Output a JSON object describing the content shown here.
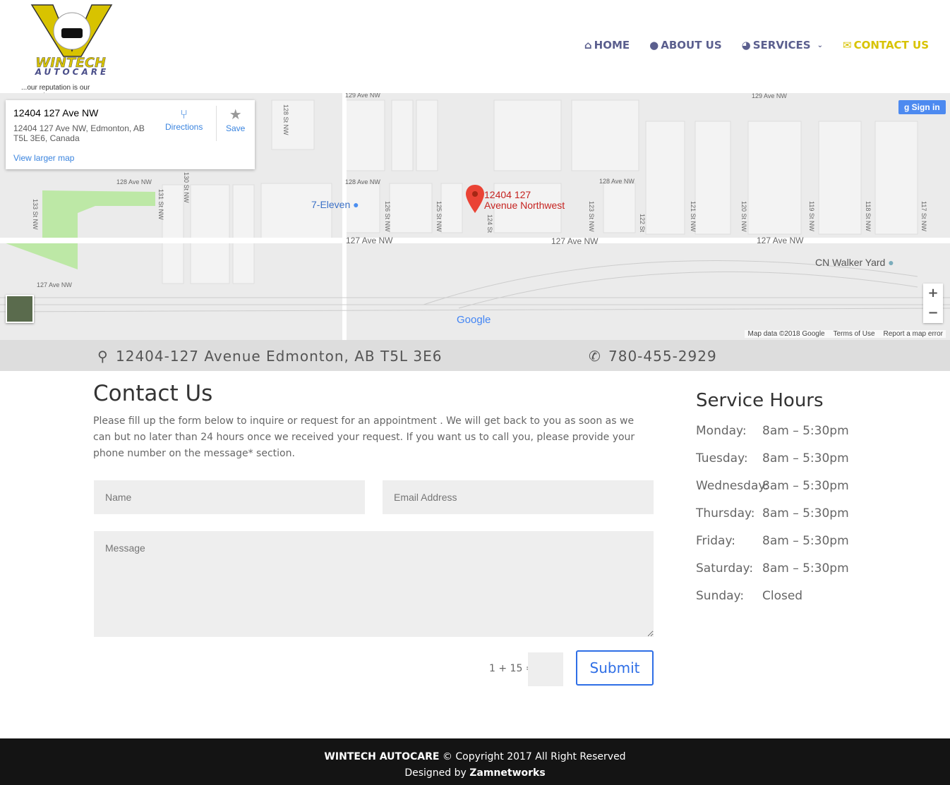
{
  "logo": {
    "brand": "WINTECH",
    "sub": "AUTOCARE",
    "tagline": "...our reputation is our guarantee"
  },
  "nav": [
    {
      "label": "HOME",
      "icon": "home-icon"
    },
    {
      "label": "ABOUT US",
      "icon": "users-icon"
    },
    {
      "label": "SERVICES",
      "icon": "pie-chart-icon"
    },
    {
      "label": "CONTACT US",
      "icon": "envelope-icon",
      "active": true
    }
  ],
  "colors": {
    "nav": "#5b5f8e",
    "accent": "#d8c300",
    "button": "#2e6ee6"
  },
  "map": {
    "place_title": "12404 127 Ave NW",
    "place_address_1": "12404 127 Ave NW, Edmonton, AB",
    "place_address_2": "T5L 3E6, Canada",
    "view_larger": "View larger map",
    "directions": "Directions",
    "save": "Save",
    "sign_in": "Sign in",
    "marker_label_1": "12404 127",
    "marker_label_2": "Avenue Northwest",
    "poi_1": "7-Eleven",
    "poi_2": "CN Walker Yard",
    "streets": [
      "129 Ave NW",
      "129 Ave NW",
      "128 Ave NW",
      "128 Ave NW",
      "128 Ave NW",
      "127 Ave NW",
      "127 Ave NW",
      "127 Ave NW",
      "127 Ave NW",
      "128 St NW",
      "130 St NW",
      "131 St NW",
      "133 St NW",
      "126 St NW",
      "125 St NW",
      "124 St",
      "123 St NW",
      "122 St",
      "121 St NW",
      "120 St NW",
      "119 St NW",
      "118 St NW",
      "117 St NW"
    ],
    "attribution": "Map data ©2018 Google",
    "terms": "Terms of Use",
    "report": "Report a map error",
    "google": "Google",
    "zoom_in": "+",
    "zoom_out": "−"
  },
  "info": {
    "address": "12404-127 Avenue Edmonton, AB T5L 3E6",
    "phone": "780-455-2929"
  },
  "contact": {
    "title": "Contact Us",
    "intro": "Please fill up the form below to inquire or request for an appointment . We will get back to you as soon as we can but no later than 24 hours once we received your request. If you want us to call you, please provide your phone number on the message* section.",
    "name_placeholder": "Name",
    "email_placeholder": "Email Address",
    "message_placeholder": "Message",
    "captcha": "1 + 15 =",
    "submit": "Submit"
  },
  "hours": {
    "title": "Service Hours",
    "rows": [
      {
        "day": "Monday:",
        "time": "8am – 5:30pm"
      },
      {
        "day": "Tuesday:",
        "time": "8am – 5:30pm"
      },
      {
        "day": "Wednesday:",
        "time": "8am – 5:30pm"
      },
      {
        "day": "Thursday:",
        "time": "8am – 5:30pm"
      },
      {
        "day": "Friday:",
        "time": "8am – 5:30pm"
      },
      {
        "day": "Saturday:",
        "time": "8am – 5:30pm"
      },
      {
        "day": "Sunday:",
        "time": "Closed"
      }
    ]
  },
  "footer": {
    "brand": "WINTECH AUTOCARE",
    "copyright": " © Copyright 2017 All Right Reserved",
    "designed": "Designed by ",
    "designer": "Zamnetworks"
  }
}
